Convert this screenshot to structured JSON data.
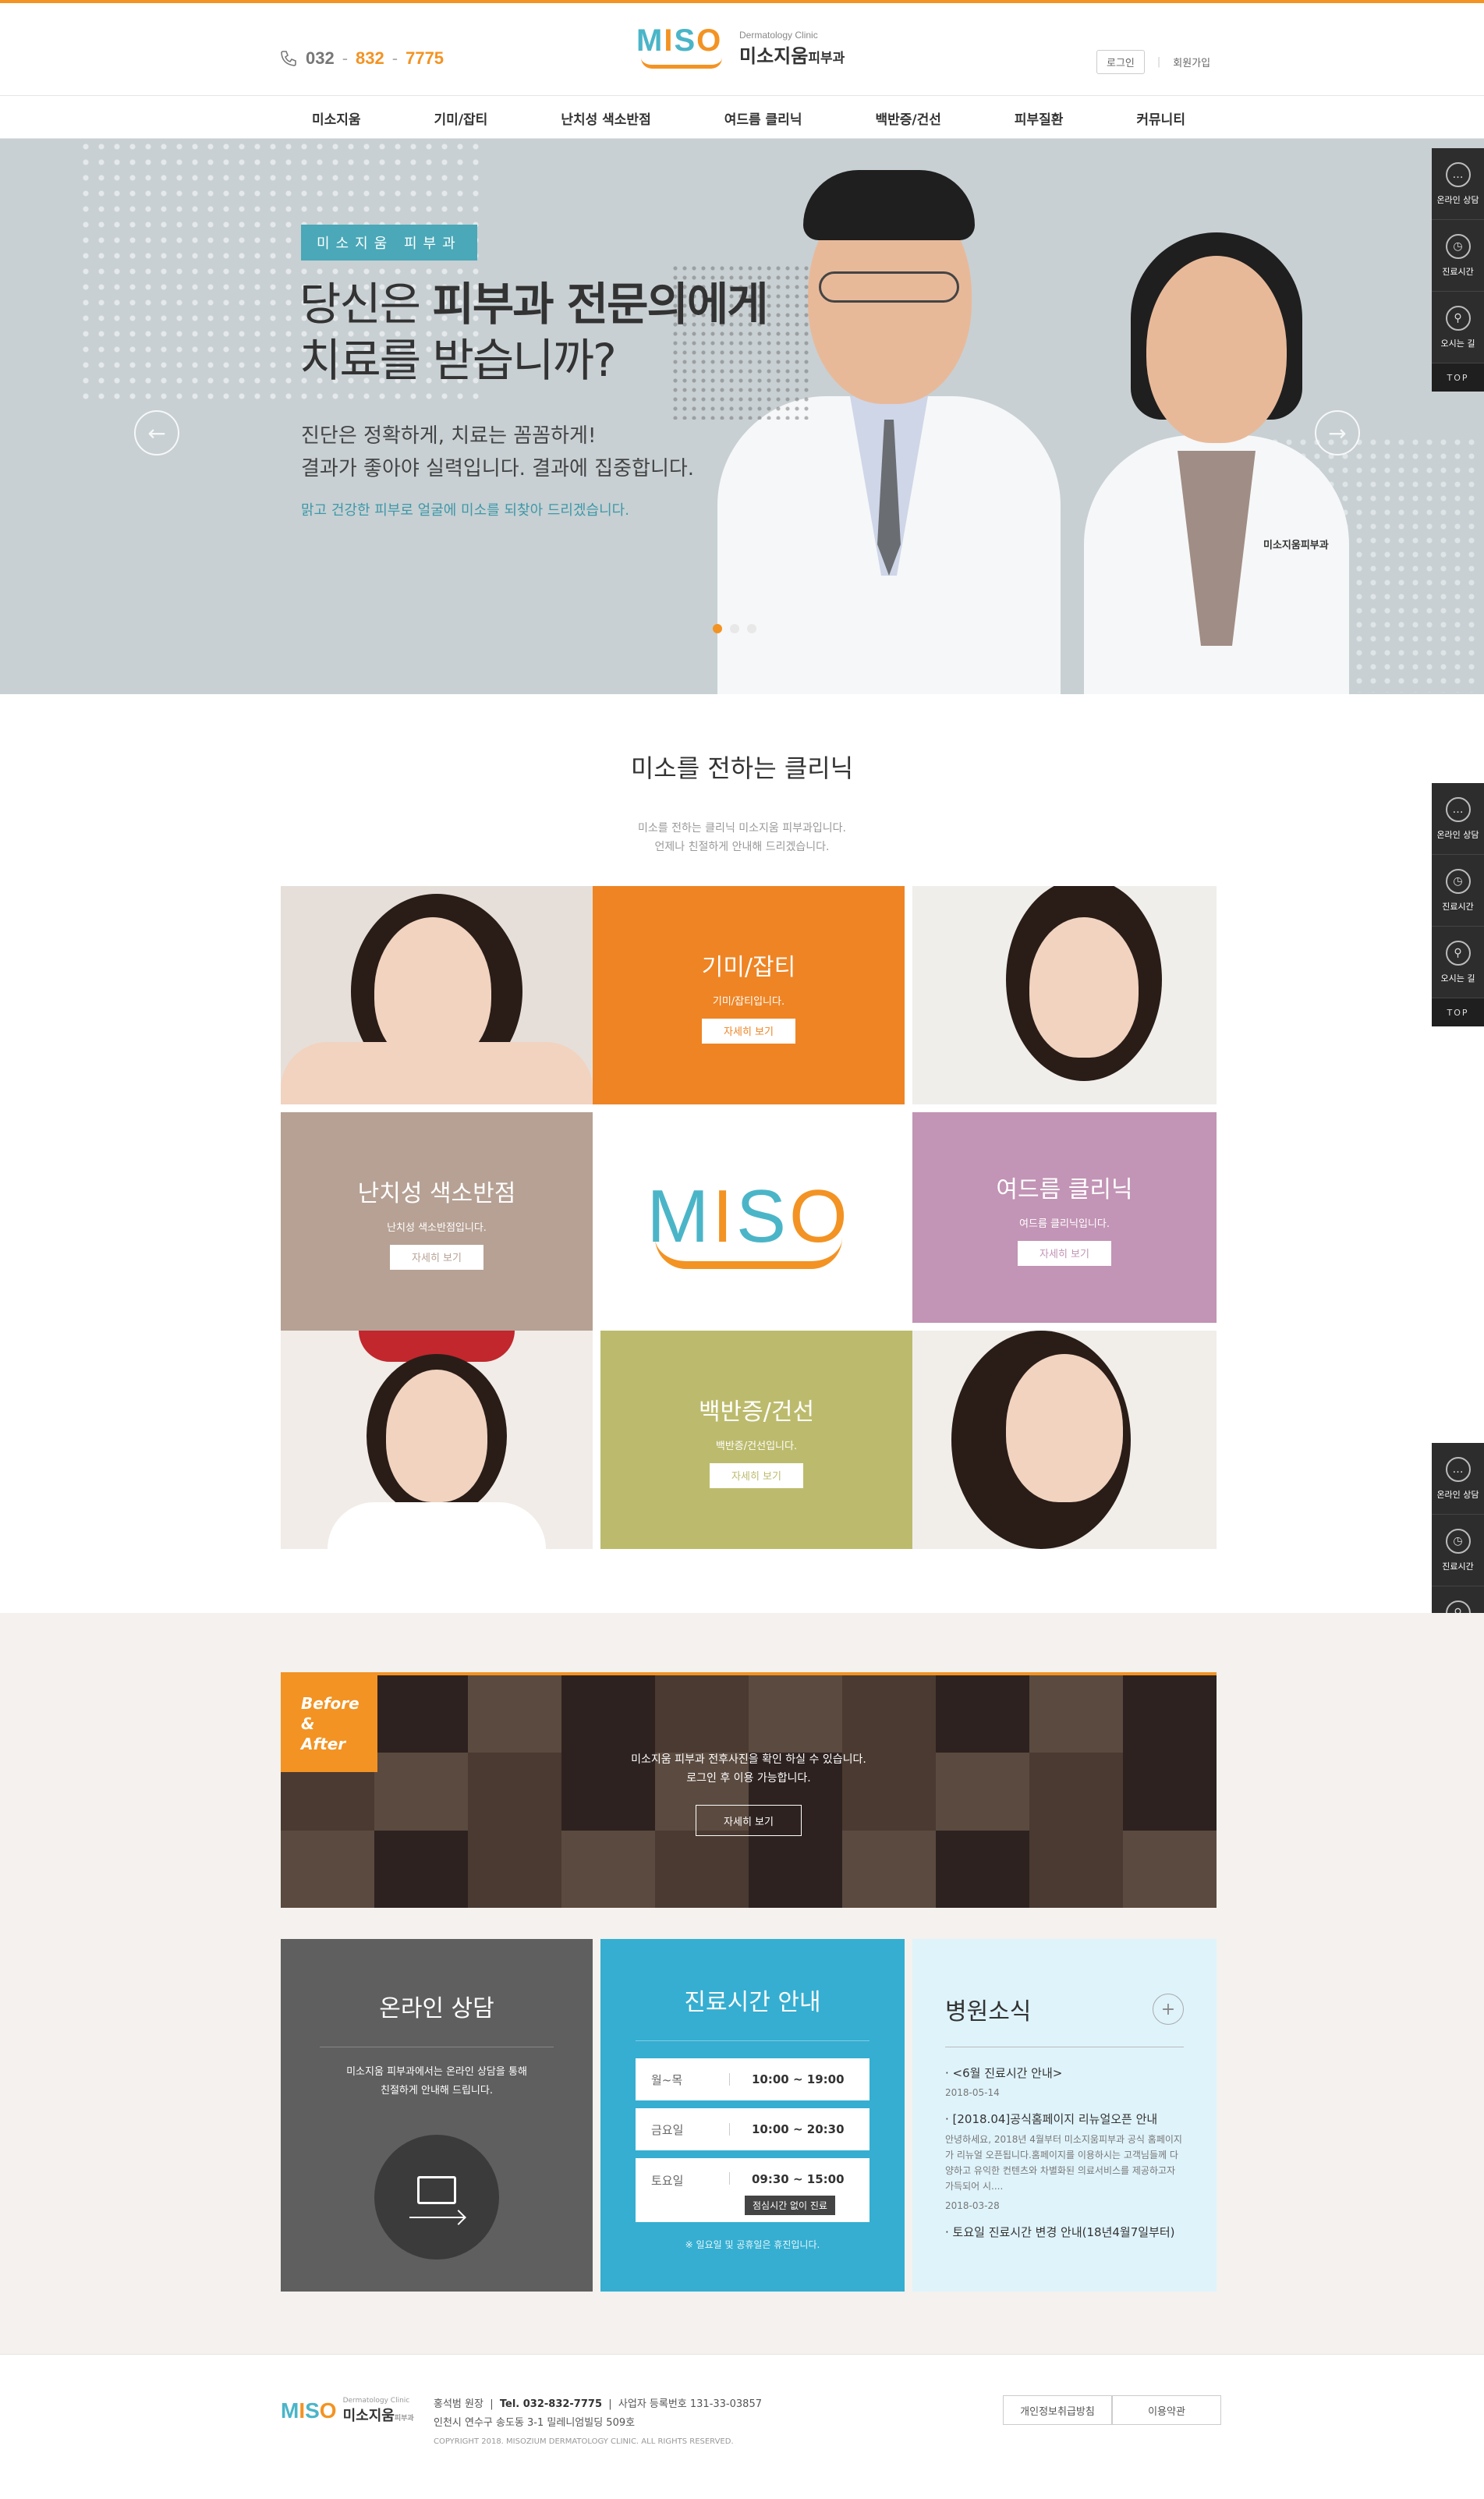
{
  "header": {
    "phone": {
      "part1": "032",
      "part2": "832",
      "part3": "7775",
      "dash": "-"
    },
    "logo": {
      "mark_m": "M",
      "mark_i": "I",
      "mark_s": "S",
      "mark_o": "O",
      "sub": "Dermatology Clinic",
      "name": "미소지움",
      "name_suffix": "피부과"
    },
    "util": {
      "login": "로그인",
      "join": "회원가입",
      "sep": "|"
    }
  },
  "nav": {
    "items": [
      "미소지움",
      "기미/잡티",
      "난치성 색소반점",
      "여드름 클리닉",
      "백반증/건선",
      "피부질환",
      "커뮤니티"
    ]
  },
  "hero": {
    "badge": "미소지움 피부과",
    "title_a": "당신은 ",
    "title_b": "피부과 전문의에게",
    "title_c": "치료를 받습니까?",
    "line1": "진단은 정확하게, 치료는 꼼꼼하게!",
    "line2": "결과가 좋아야 실력입니다. 결과에 집중합니다.",
    "sub": "맑고 건강한 피부로 얼굴에 미소를 되찾아 드리겠습니다.",
    "arrow_left": "←",
    "arrow_right": "→",
    "coat_badge": "미소지움피부과"
  },
  "quick": {
    "counsel": "온라인 상담",
    "hours": "진료시간",
    "directions": "오시는 길",
    "top": "TOP",
    "icons": [
      "chat-icon",
      "clock-icon",
      "map-pin-icon"
    ]
  },
  "clinic": {
    "title": "미소를 전하는 클리닉",
    "desc1": "미소를 전하는 클리닉 미소지움 피부과입니다.",
    "desc2": "언제나 친절하게 안내해 드리겠습니다.",
    "more": "자세히 보기",
    "cards": [
      {
        "title": "기미/잡티",
        "text": "기미/잡티입니다.",
        "color": "#ee8424"
      },
      {
        "title": "난치성 색소반점",
        "text": "난치성 색소반점입니다.",
        "color": "#b6a194"
      },
      {
        "title": "여드름 클리닉",
        "text": "여드름 클리닉입니다.",
        "color": "#c294b5"
      },
      {
        "title": "백반증/건선",
        "text": "백반증/건선입니다.",
        "color": "#bcbb6d"
      }
    ]
  },
  "before_after": {
    "tag1": "Before &",
    "tag2": "After",
    "text1": "미소지움 피부과 전후사진을 확인 하실 수 있습니다.",
    "text2": "로그인 후 이용 가능합니다.",
    "button": "자세히 보기"
  },
  "online": {
    "title": "온라인 상담",
    "text1": "미소지움 피부과에서는 온라인 상담을 통해",
    "text2": "친절하게 안내해 드립니다."
  },
  "hours": {
    "title": "진료시간 안내",
    "rows": [
      {
        "day": "월~목",
        "time": "10:00 ~ 19:00"
      },
      {
        "day": "금요일",
        "time": "10:00 ~ 20:30"
      },
      {
        "day": "토요일",
        "time": "09:30 ~ 15:00",
        "note": "점심시간 없이 진료"
      }
    ],
    "footnote": "※ 일요일 및 공휴일은 휴진입니다."
  },
  "news": {
    "title": "병원소식",
    "plus": "+",
    "items": [
      {
        "title": "· <6월 진료시간 안내>",
        "date": "2018-05-14"
      },
      {
        "title": "· [2018.04]공식홈페이지 리뉴얼오픈 안내",
        "body": "안녕하세요, 2018년 4월부터 미소지움피부과 공식 홈페이지가 리뉴얼 오픈됩니다.홈페이지를 이용하시는 고객님들께 다양하고 유익한 컨텐츠와 차별화된 의료서비스를 제공하고자가득되어 시....",
        "date": "2018-03-28"
      },
      {
        "title": "· 토요일 진료시간 변경 안내(18년4월7일부터)"
      }
    ]
  },
  "footer": {
    "logo_sub": "Dermatology Clinic",
    "logo_name": "미소지움",
    "logo_suffix": "피부과",
    "director": "홍석범 원장",
    "tel": "Tel. 032-832-7775",
    "biz": "사업자 등록번호 131-33-03857",
    "address": "인천시 연수구 송도동 3-1 밀레니엄빌딩 509호",
    "copyright": "COPYRIGHT 2018. MISOZIUM DERMATOLOGY CLINIC. ALL RIGHTS RESERVED.",
    "privacy": "개인정보취급방침",
    "terms": "이용약관"
  }
}
